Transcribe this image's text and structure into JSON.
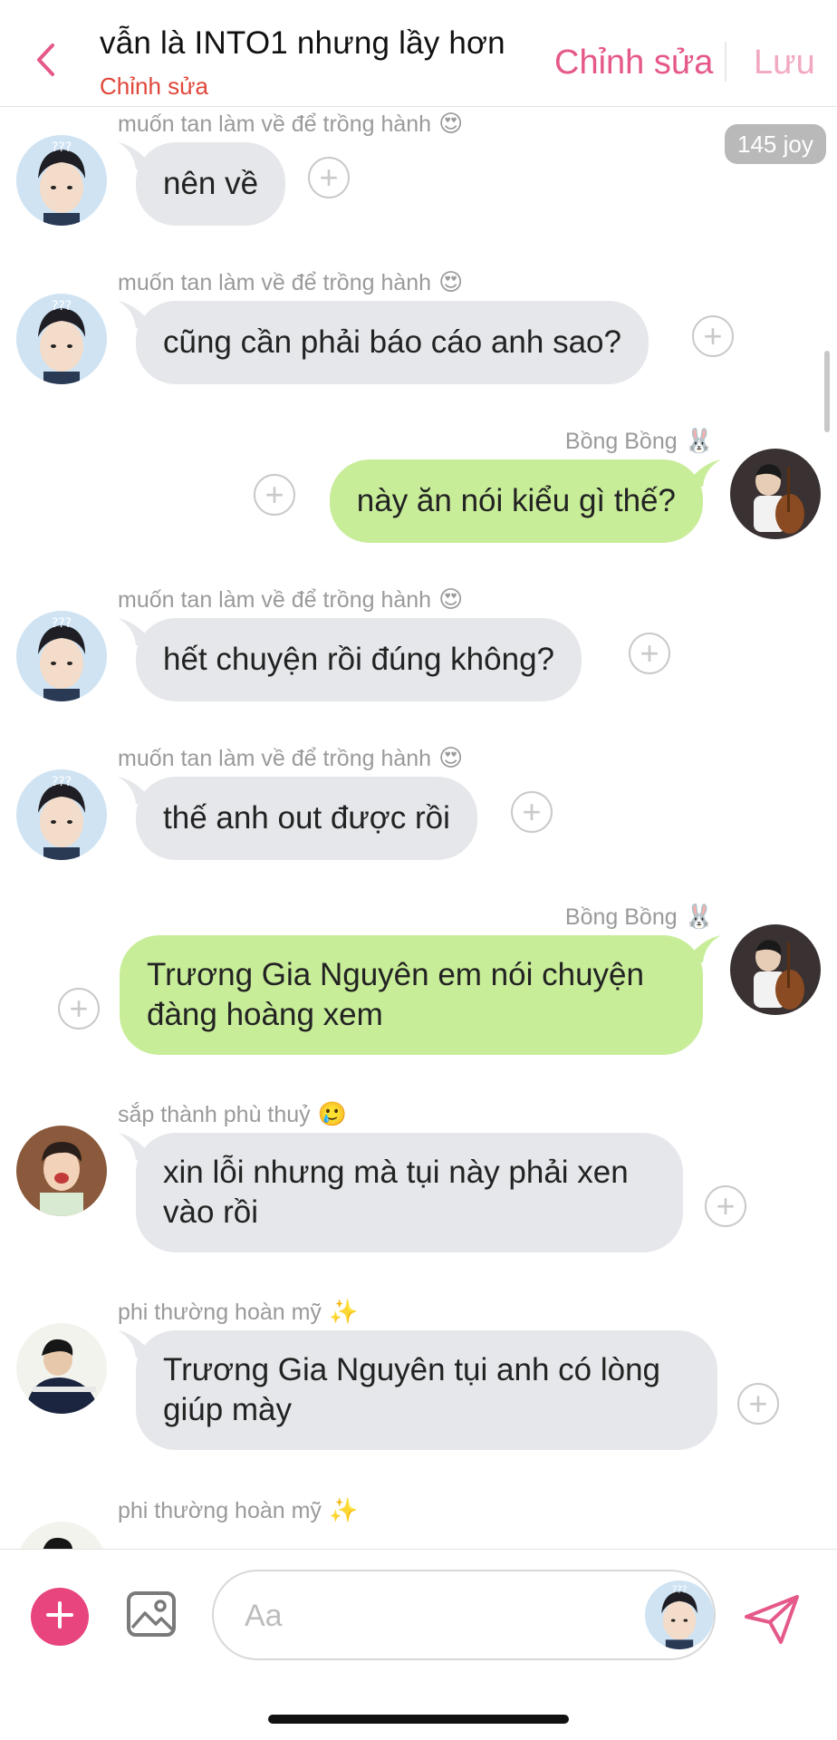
{
  "header": {
    "title": "vẫn là INTO1 nhưng lầy hơn",
    "subtitle": "Chỉnh sửa",
    "edit_label": "Chỉnh sửa",
    "save_label": "Lưu",
    "back_icon": "chevron-left-icon"
  },
  "joy_badge": "145 joy",
  "colors": {
    "accent": "#e5588a",
    "subtitle": "#e0473a",
    "bubble_in": "#e5e7ea",
    "bubble_out": "#c8ed99",
    "add_button": "#e8447e"
  },
  "messages": [
    {
      "sender": "muốn tan làm về để trồng hành",
      "emoji": "😍",
      "text": "nên về",
      "side": "in"
    },
    {
      "sender": "muốn tan làm về để trồng hành",
      "emoji": "😍",
      "text": "cũng cần phải báo cáo anh sao?",
      "side": "in"
    },
    {
      "sender": "Bồng Bồng",
      "emoji": "🐰",
      "text": "này ăn nói kiểu gì thế?",
      "side": "out"
    },
    {
      "sender": "muốn tan làm về để trồng hành",
      "emoji": "😍",
      "text": "hết chuyện rồi đúng không?",
      "side": "in"
    },
    {
      "sender": "muốn tan làm về để trồng hành",
      "emoji": "😍",
      "text": "thế anh out được rồi",
      "side": "in"
    },
    {
      "sender": "Bồng Bồng",
      "emoji": "🐰",
      "text_lines": [
        "Trương Gia Nguyên em nói chuyện",
        "đàng hoàng xem"
      ],
      "side": "out"
    },
    {
      "sender": "sắp thành phù thuỷ",
      "emoji": "🥲",
      "text_lines": [
        "xin lỗi nhưng mà tụi này phải xen",
        "vào rồi"
      ],
      "side": "in"
    },
    {
      "sender": "phi thường hoàn mỹ",
      "emoji": "✨",
      "text_lines": [
        "Trương Gia Nguyên tụi anh có lòng",
        "giúp mày"
      ],
      "side": "in"
    },
    {
      "sender": "phi thường hoàn mỹ",
      "emoji": "✨",
      "side": "in"
    }
  ],
  "avatar_label": "???",
  "composer": {
    "placeholder": "Aa",
    "add_icon": "plus-icon",
    "image_icon": "image-icon",
    "send_icon": "send-icon"
  }
}
